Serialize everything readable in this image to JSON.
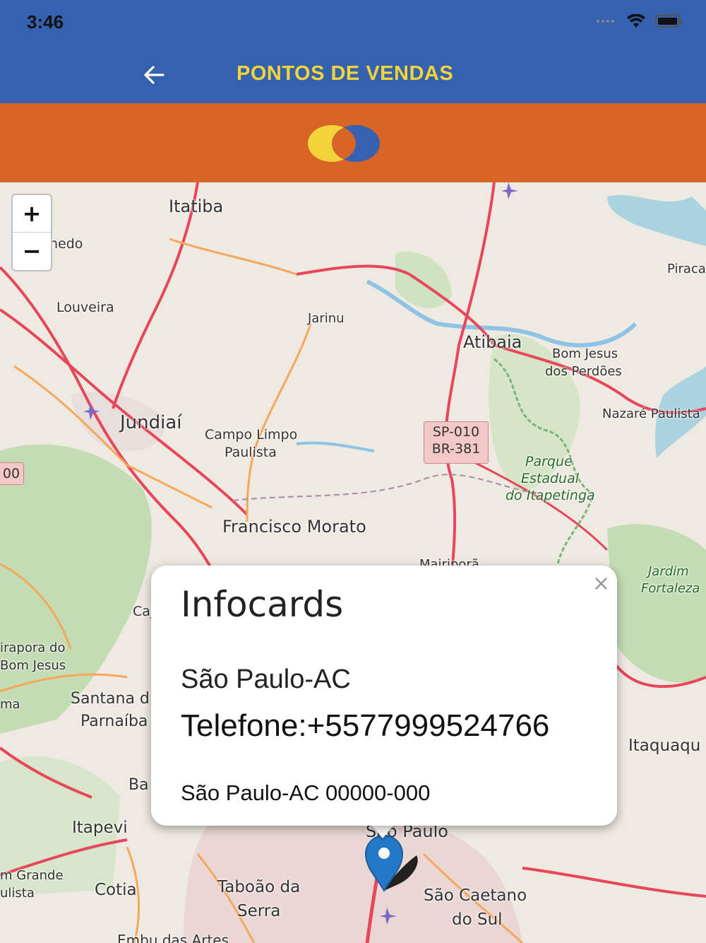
{
  "status_bar": {
    "time": "3:46"
  },
  "app_bar": {
    "title": "PONTOS DE VENDAS",
    "back_icon": "arrow-left-icon"
  },
  "brand": {
    "logo": "overlapping-circles-logo",
    "colors": {
      "blue": "#3461b0",
      "orange": "#d86425",
      "yellow": "#f2d43a"
    }
  },
  "map": {
    "zoom_in": "+",
    "zoom_out": "−",
    "labels": {
      "itatiba": "Itatiba",
      "hedo": "hedo",
      "piraca": "Piraca",
      "louveira": "Louveira",
      "jarinu": "Jarinu",
      "atibaia": "Atibaia",
      "bom_jesus": "Bom Jesus",
      "dos_perdoes": "dos Perdões",
      "nazare": "Nazaré Paulista",
      "jundiai": "Jundiaí",
      "campo_limpo": "Campo Limpo",
      "paulista": "Paulista",
      "parque": "Parque",
      "estadual": "Estadual",
      "itapetinga": "do Itapetinga",
      "francisco_morato": "Francisco Morato",
      "mairipora": "Mairiporã",
      "jardim": "Jardim",
      "fortaleza": "Fortaleza",
      "caj": "Caj",
      "pirapora": "irapora do",
      "bom_jesus2": "Bom Jesus",
      "ma": "ma",
      "santana": "Santana d",
      "parnaiba": "Parnaíba",
      "itaquaqu": "Itaquaqu",
      "ba": "Ba",
      "itapevi": "Itapevi",
      "sao_paulo": "São Paulo",
      "m_grande": "m Grande",
      "ulista": "ulista",
      "cotia": "Cotia",
      "taboao": "Taboão da",
      "serra": "Serra",
      "sao_caetano": "São Caetano",
      "do_sul": "do Sul",
      "embu": "Embu das Artes",
      "shield_00": "00",
      "shield_sp": "SP-010",
      "shield_br": "BR-381"
    }
  },
  "popup": {
    "title": "Infocards",
    "city": "São Paulo-AC",
    "phone": "Telefone:+5577999524766",
    "address": "São Paulo-AC 00000-000",
    "close": "×"
  }
}
